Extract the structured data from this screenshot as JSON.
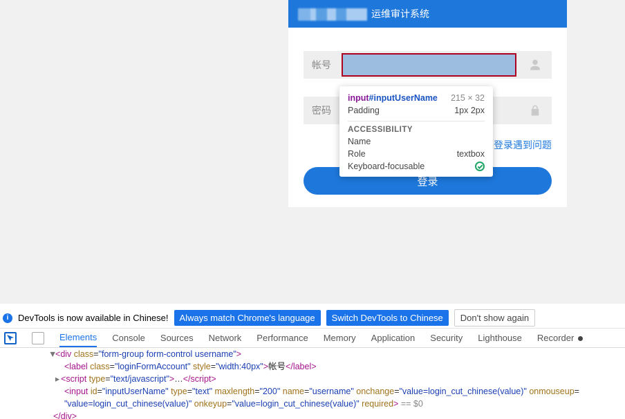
{
  "header": {
    "title_suffix": "运维审计系统"
  },
  "form": {
    "username_label": "帐号",
    "password_label": "密码",
    "trouble_link": "登录遇到问题",
    "login_button": "登录"
  },
  "inspector": {
    "selector_tag": "input",
    "selector_id": "#inputUserName",
    "dimensions": "215 × 32",
    "padding_label": "Padding",
    "padding_value": "1px 2px",
    "a11y_heading": "ACCESSIBILITY",
    "name_label": "Name",
    "role_label": "Role",
    "role_value": "textbox",
    "kf_label": "Keyboard-focusable"
  },
  "devtools_hint": {
    "message": "DevTools is now available in Chinese!",
    "match_btn": "Always match Chrome's language",
    "switch_btn": "Switch DevTools to Chinese",
    "dismiss_btn": "Don't show again"
  },
  "tabs": {
    "elements": "Elements",
    "console": "Console",
    "sources": "Sources",
    "network": "Network",
    "performance": "Performance",
    "memory": "Memory",
    "application": "Application",
    "security": "Security",
    "lighthouse": "Lighthouse",
    "recorder": "Recorder"
  },
  "code": {
    "l1_a": "<",
    "l1_tag": "div",
    "l1_attr1": " class",
    "l1_eq": "=",
    "l1_v1": "\"form-group form-control username\"",
    "l1_z": ">",
    "l2_a": "<",
    "l2_tag": "label",
    "l2_attr1": " class",
    "l2_v1": "\"loginFormAccount\"",
    "l2_attr2": " style",
    "l2_v2": "\"width:40px\"",
    "l2_z": ">",
    "l2_txt": "帐号",
    "l2_c": "</",
    "l2_ctag": "label",
    "l2_cz": ">",
    "l3_a": "<",
    "l3_tag": "script",
    "l3_attr1": " type",
    "l3_v1": "\"text/javascript\"",
    "l3_z": ">",
    "l3_ell": "…",
    "l3_c": "</",
    "l3_ctag": "script",
    "l3_cz": ">",
    "l4_a": "<",
    "l4_tag": "input",
    "l4_attr1": " id",
    "l4_v1": "\"inputUserName\"",
    "l4_attr2": " type",
    "l4_v2": "\"text\"",
    "l4_attr3": " maxlength",
    "l4_v3": "\"200\"",
    "l4_attr4": " name",
    "l4_v4": "\"username\"",
    "l4_attr5": " onchange",
    "l4_v5": "\"value=login_cut_chinese(value)\"",
    "l4_attr6": " onmouseup",
    "l4_v6": "=",
    "l5_v1": "\"value=login_cut_chinese(value)\"",
    "l5_attr2": " onkeyup",
    "l5_v2": "\"value=login_cut_chinese(value)\"",
    "l5_attr3": " required",
    "l5_z": ">",
    "l5_sel": " == $0",
    "l6_c": "</",
    "l6_tag": "div",
    "l6_z": ">"
  }
}
